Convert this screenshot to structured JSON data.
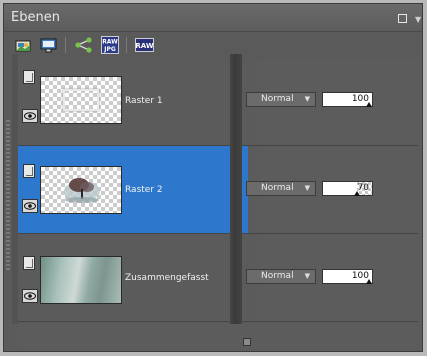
{
  "panel": {
    "title": "Ebenen",
    "maximize_icon": "square-icon",
    "menu_icon": "chevron-down-icon"
  },
  "toolbar": {
    "icons": [
      "new-layer-icon",
      "layer-properties-icon",
      "share-icon",
      "raw-jpg-icon",
      "raw-icon"
    ],
    "raw_top": "RAW",
    "jpg_bottom": "JPG",
    "raw_label": "RAW"
  },
  "layers": [
    {
      "name": "Raster 1",
      "blend_mode": "Normal",
      "opacity": "100",
      "opacity_fraction": 1.0,
      "selected": false,
      "thumbnail": "frame-on-transparent"
    },
    {
      "name": "Raster 2",
      "blend_mode": "Normal",
      "opacity": "70",
      "opacity_fraction": 0.7,
      "selected": true,
      "thumbnail": "tree-on-transparent"
    },
    {
      "name": "Zusammengefasst",
      "blend_mode": "Normal",
      "opacity": "100",
      "opacity_fraction": 1.0,
      "selected": false,
      "thumbnail": "merged-teal-texture"
    }
  ],
  "colors": {
    "selection": "#2d78cc",
    "panel_bg": "#5b5b5b"
  }
}
